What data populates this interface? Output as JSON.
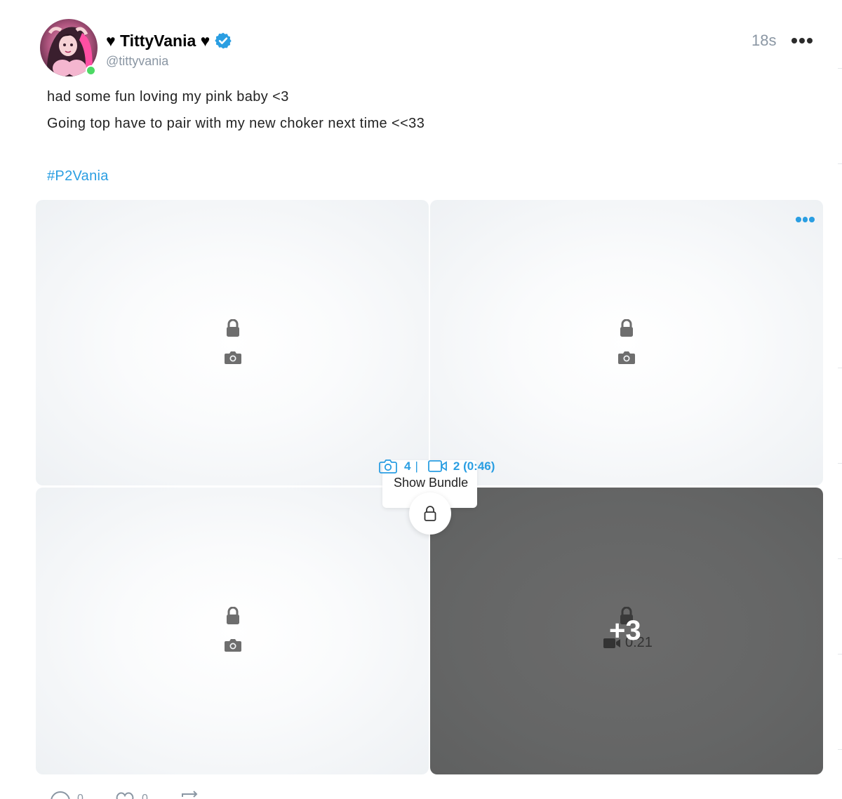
{
  "post": {
    "author": {
      "display_name": "♥ TittyVania ♥",
      "handle": "@tittyvania",
      "verified": true,
      "online": true
    },
    "timestamp": "18s",
    "text_lines": [
      "had some fun loving my pink baby <3",
      "Going top have to pair with my new choker next time <<33"
    ],
    "hashtag": "#P2Vania",
    "media": {
      "tiles": [
        {
          "type": "photo",
          "locked": true
        },
        {
          "type": "photo",
          "locked": true
        },
        {
          "type": "photo",
          "locked": true
        },
        {
          "type": "video",
          "locked": true,
          "duration": "0:21",
          "overlay": "+3"
        }
      ],
      "bundle": {
        "photo_count": "4",
        "separator": "|",
        "video_count": "2 (0:46)",
        "show_label": "Show Bundle"
      }
    },
    "actions": {
      "comments": "0",
      "likes": "0"
    }
  },
  "colors": {
    "accent": "#2a9ee2",
    "muted": "#8a96a3",
    "online": "#4cd964",
    "locked_dark_tile": "#656666"
  }
}
